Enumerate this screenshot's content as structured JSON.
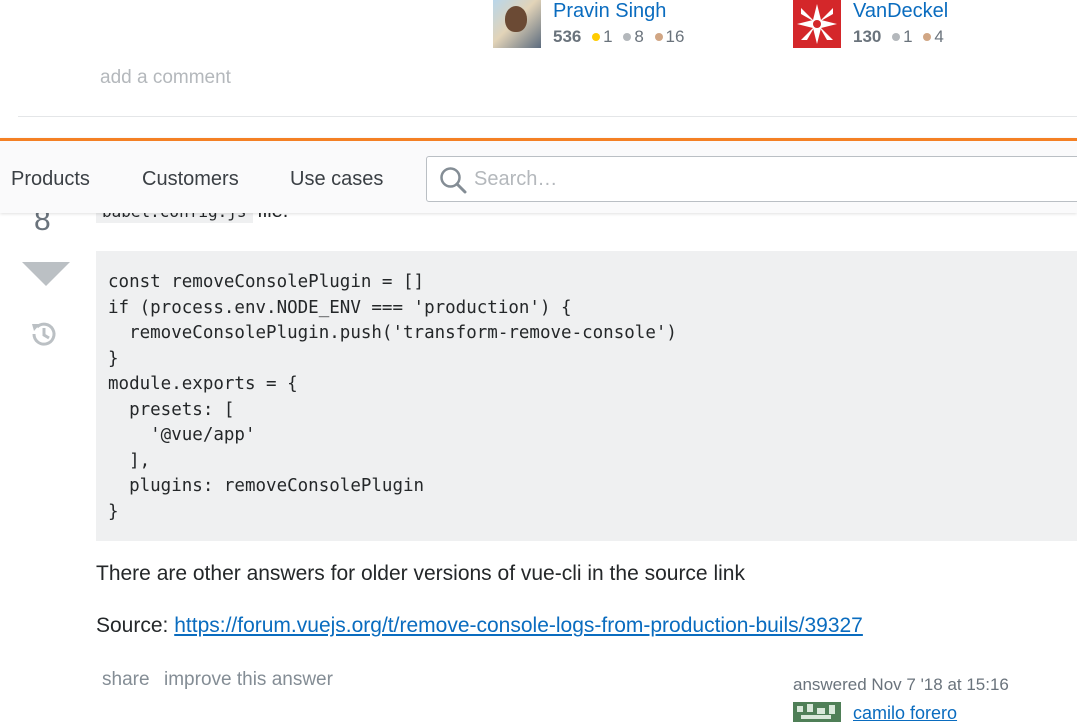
{
  "signatures": [
    {
      "name": "Pravin Singh",
      "reputation": "536",
      "gold": "1",
      "silver": "8",
      "bronze": "16"
    },
    {
      "name": "VanDeckel",
      "reputation": "130",
      "silver": "1",
      "bronze": "4"
    }
  ],
  "add_comment": "add a comment",
  "nav": {
    "products": "Products",
    "customers": "Customers",
    "use_cases": "Use cases",
    "search_placeholder": "Search…"
  },
  "answer": {
    "vote_count": "8",
    "inline_code": "babel.config.js",
    "inline_after": "file.",
    "code": "const removeConsolePlugin = []\nif (process.env.NODE_ENV === 'production') {\n  removeConsolePlugin.push('transform-remove-console')\n}\nmodule.exports = {\n  presets: [\n    '@vue/app'\n  ],\n  plugins: removeConsolePlugin\n}",
    "paragraph": "There are other answers for older versions of vue-cli in the source link",
    "source_label": "Source: ",
    "source_url": "https://forum.vuejs.org/t/remove-console-logs-from-production-buils/39327",
    "share": "share",
    "improve": "improve this answer",
    "answered": "answered Nov 7 '18 at 15:16",
    "author": "camilo forero"
  },
  "colors": {
    "accent_orange": "#f48024",
    "link_blue": "#0a6cbf",
    "gold_badge": "#ffcc01",
    "silver_badge": "#b4b8bc",
    "bronze_badge": "#d1a684"
  }
}
